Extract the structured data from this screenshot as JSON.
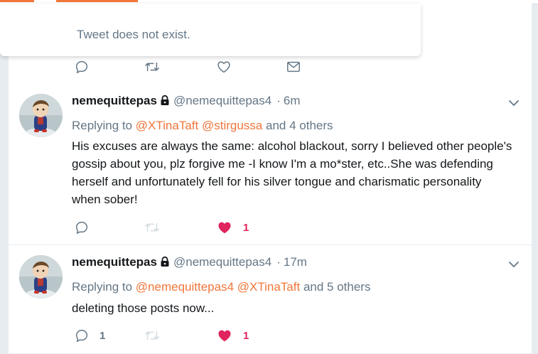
{
  "colors": {
    "accent": "#f0763a",
    "like": "#e0245e",
    "muted": "#657786",
    "text": "#14171a"
  },
  "popup": {
    "message": "Tweet does not exist."
  },
  "tweets": [
    {
      "name": "nemequittepas",
      "handle": "@nemequittepas4",
      "dot": "·",
      "time": "6m",
      "reply_prefix": "Replying to",
      "mentions": [
        "@XTinaTaft",
        "@stirgussa"
      ],
      "reply_suffix": "and 4 others",
      "text": "His excuses are always the same: alcohol blackout, sorry I believed other people's gossip about you, plz forgive me -I know I'm a mo*ster, etc..She was defending herself and unfortunately fell for his silver tongue and charismatic personality when sober!",
      "like_count": "1"
    },
    {
      "name": "nemequittepas",
      "handle": "@nemequittepas4",
      "dot": "·",
      "time": "17m",
      "reply_prefix": "Replying to",
      "mentions": [
        "@nemequittepas4",
        "@XTinaTaft"
      ],
      "reply_suffix": "and 5 others",
      "text": "deleting those posts now...",
      "reply_count": "1",
      "like_count": "1"
    }
  ]
}
